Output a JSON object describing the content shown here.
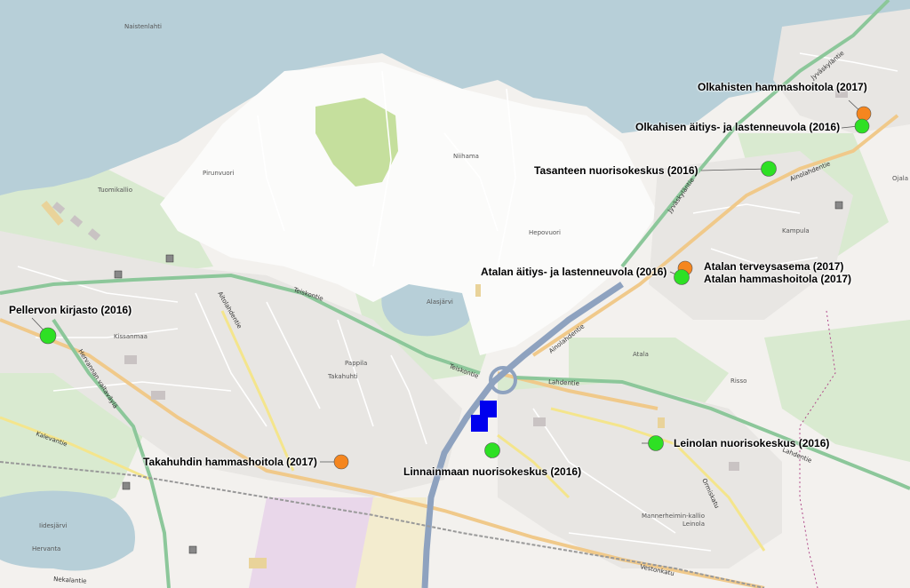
{
  "map": {
    "colors": {
      "water": "#b7cfd8",
      "land": "#f3f1ee",
      "forest": "#d9ead0",
      "field": "#c5df9d",
      "residential": "#e8e6e3",
      "industrial": "#e9d7ea",
      "motorway": "#8ea2bf",
      "trunk": "#8cc79a",
      "primary": "#f0c98a",
      "secondary": "#f4e58c",
      "marker_green": "#2ee024",
      "marker_orange": "#f5861f",
      "marker_blue": "#0000ee",
      "marker_grey": "#888888"
    },
    "services": [
      {
        "label": "Olkahisten hammashoitola (2017)",
        "color": "orange"
      },
      {
        "label": "Olkahisen äitiys- ja lastenneuvola (2016)",
        "color": "green"
      },
      {
        "label": "Tasanteen nuorisokeskus (2016)",
        "color": "green"
      },
      {
        "label": "Atalan äitiys- ja lastenneuvola (2016)",
        "color": "green"
      },
      {
        "label": "Atalan terveysasema (2017)",
        "color": "orange"
      },
      {
        "label": "Atalan hammashoitola (2017)",
        "color": "green"
      },
      {
        "label": "Pellervon kirjasto (2016)",
        "color": "green"
      },
      {
        "label": "Leinolan nuorisokeskus (2016)",
        "color": "green"
      },
      {
        "label": "Takahuhdin hammashoitola (2017)",
        "color": "orange"
      },
      {
        "label": "Linnainmaan nuorisokeskus (2016)",
        "color": "green"
      }
    ],
    "road_labels": [
      "Teiskontie",
      "Teiskontie",
      "Ainolahdentie",
      "Ainolahdentie",
      "Lahdentie",
      "Lahdentie",
      "Jyväskyläntie",
      "Jyväskyläntie",
      "Hervannan valtaväylä",
      "Kalevantie",
      "Nekalantie",
      "Vestonkatu",
      "Ormiskatu",
      "Aitolahdentie"
    ],
    "place_labels": [
      "Naistenlahti",
      "Pirunvuori",
      "Tuomikallio",
      "Niihama",
      "Hepovuori",
      "Alasjärvi",
      "Kissanmaa",
      "Pappila",
      "Atala",
      "Risso",
      "Leinola",
      "Mannerheimin-kallio",
      "Hervanta",
      "Iidesjärvi",
      "Takahuhti",
      "Ojala",
      "Kampula"
    ]
  }
}
